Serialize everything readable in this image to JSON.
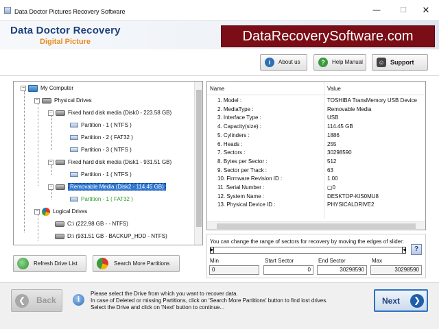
{
  "window": {
    "title": "Data Doctor Pictures Recovery Software",
    "min_glyph": "—",
    "max_glyph": "☐",
    "close_glyph": "✕"
  },
  "banner": {
    "brand_line1": "Data Doctor Recovery",
    "brand_line2": "Digital Picture",
    "site": "DataRecoverySoftware.com"
  },
  "toolbar": {
    "about": "About us",
    "manual": "Help Manual",
    "support": "Support"
  },
  "tree": {
    "root": "My Computer",
    "physical": "Physical Drives",
    "disk0": "Fixed hard disk media (Disk0 - 223.58 GB)",
    "disk0_parts": [
      "Partition - 1 ( NTFS )",
      "Partition - 2 ( FAT32 )",
      "Partition - 3 ( NTFS )"
    ],
    "disk1": "Fixed hard disk media (Disk1 - 931.51 GB)",
    "disk1_parts": [
      "Partition - 1 ( NTFS )"
    ],
    "disk2": "Removable Media (Disk2 - 114.45 GB)",
    "disk2_parts": [
      "Partition - 1 ( FAT32 )"
    ],
    "logical": "Logical Drives",
    "logical_items": [
      "C:\\ (222.98 GB -  - NTFS)",
      "D:\\ (931.51 GB - BACKUP_HDD - NTFS)"
    ]
  },
  "properties": {
    "col_name": "Name",
    "col_value": "Value",
    "rows": [
      {
        "name": "1. Model :",
        "value": "TOSHIBA TransMemory USB Device"
      },
      {
        "name": "2. MediaType :",
        "value": "Removable Media"
      },
      {
        "name": "3. Interface Type :",
        "value": "USB"
      },
      {
        "name": "4. Capacity(size) :",
        "value": "114.45 GB"
      },
      {
        "name": "5. Cylinders :",
        "value": "1886"
      },
      {
        "name": "6. Heads :",
        "value": "255"
      },
      {
        "name": "7. Sectors :",
        "value": "30298590"
      },
      {
        "name": "8. Bytes per Sector :",
        "value": "512"
      },
      {
        "name": "9. Sector per Track :",
        "value": "63"
      },
      {
        "name": "10. Firmware Revision ID :",
        "value": "1.00"
      },
      {
        "name": "11. Serial Number :",
        "value": "▢0"
      },
      {
        "name": "12. System Name :",
        "value": "DESKTOP-KIS0MU8"
      },
      {
        "name": "13. Physical Device ID :",
        "value": "PHYSICALDRIVE2"
      }
    ]
  },
  "slider": {
    "hint": "You can change the range of sectors for recovery by moving the edges of slider:",
    "help": "?",
    "min_label": "Min",
    "start_label": "Start Sector",
    "end_label": "End Sector",
    "max_label": "Max",
    "min_value": "0",
    "start_value": "0",
    "end_value": "30298590",
    "max_value": "30298590"
  },
  "actions": {
    "refresh": "Refresh Drive List",
    "search": "Search More Partitions"
  },
  "footer": {
    "back": "Back",
    "next": "Next",
    "info_lines": [
      "Please select the Drive from which you want to recover data.",
      "In case of Deleted or missing Partitions, click on 'Search More Partitions' button to find lost drives.",
      "Select the Drive and click on 'Next' button to continue..."
    ]
  }
}
